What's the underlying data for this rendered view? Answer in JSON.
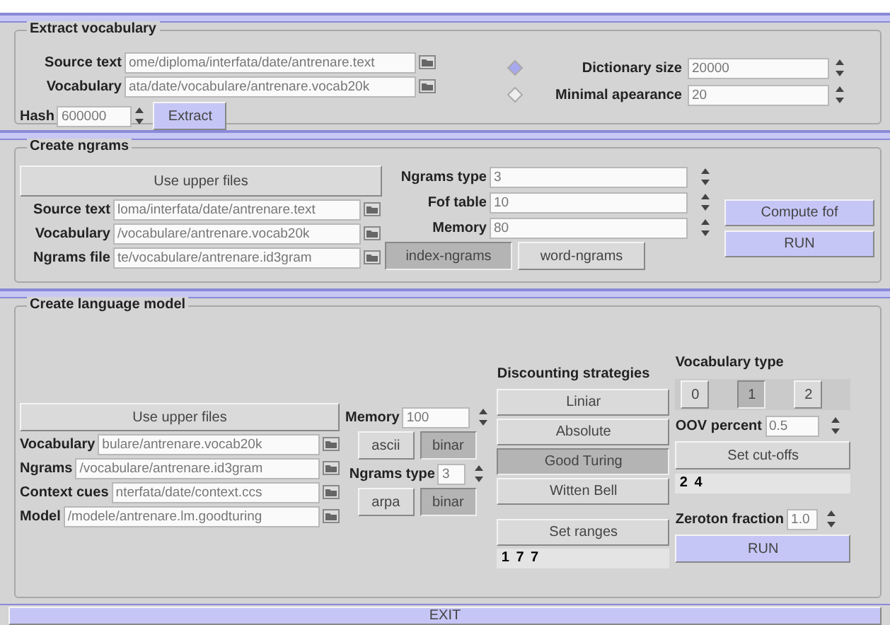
{
  "extract": {
    "title": "Extract vocabulary",
    "files": [
      {
        "label": "Source text",
        "value": "ome/diploma/interfata/date/antrenare.text"
      },
      {
        "label": "Vocabulary",
        "value": "ata/date/vocabulare/antrenare.vocab20k"
      }
    ],
    "hash": {
      "label": "Hash",
      "value": "600000"
    },
    "extract_button": "Extract",
    "options": [
      {
        "label": "Dictionary size",
        "value": "20000",
        "selected": true
      },
      {
        "label": "Minimal apearance",
        "value": "20",
        "selected": false
      }
    ]
  },
  "ngrams": {
    "title": "Create ngrams",
    "use_upper": "Use upper files",
    "files": [
      {
        "label": "Source text",
        "value": "loma/interfata/date/antrenare.text"
      },
      {
        "label": "Vocabulary",
        "value": "/vocabulare/antrenare.vocab20k"
      },
      {
        "label": "Ngrams file",
        "value": "te/vocabulare/antrenare.id3gram"
      }
    ],
    "params": [
      {
        "label": "Ngrams type",
        "value": "3"
      },
      {
        "label": "Fof table",
        "value": "10"
      },
      {
        "label": "Memory",
        "value": "80"
      }
    ],
    "modes": [
      {
        "label": "index-ngrams",
        "selected": true
      },
      {
        "label": "word-ngrams",
        "selected": false
      }
    ],
    "compute_button": "Compute fof",
    "run_button": "RUN"
  },
  "language_model": {
    "title": "Create language model",
    "use_upper": "Use upper files",
    "files": [
      {
        "label": "Vocabulary",
        "value": "bulare/antrenare.vocab20k"
      },
      {
        "label": "Ngrams",
        "value": "/vocabulare/antrenare.id3gram"
      },
      {
        "label": "Context cues",
        "value": "nterfata/date/context.ccs"
      },
      {
        "label": "Model",
        "value": "/modele/antrenare.lm.goodturing"
      }
    ],
    "memory": {
      "label": "Memory",
      "value": "100"
    },
    "memory_format": [
      {
        "label": "ascii",
        "selected": false
      },
      {
        "label": "binar",
        "selected": true
      }
    ],
    "ngrams_type": {
      "label": "Ngrams type",
      "value": "3"
    },
    "output_format": [
      {
        "label": "arpa",
        "selected": false
      },
      {
        "label": "binar",
        "selected": true
      }
    ],
    "discounting": {
      "title": "Discounting strategies",
      "options": [
        {
          "label": "Liniar",
          "selected": false
        },
        {
          "label": "Absolute",
          "selected": false
        },
        {
          "label": "Good Turing",
          "selected": true
        },
        {
          "label": "Witten Bell",
          "selected": false
        }
      ],
      "set_ranges": "Set ranges",
      "ranges_reading": "1 7 7"
    },
    "vocabulary_type": {
      "title": "Vocabulary type",
      "options": [
        {
          "label": "0",
          "selected": false
        },
        {
          "label": "1",
          "selected": true
        },
        {
          "label": "2",
          "selected": false
        }
      ]
    },
    "oov": {
      "label": "OOV percent",
      "value": "0.5"
    },
    "cutoffs_button": "Set cut-offs",
    "cutoffs_reading": "2 4",
    "zeroton": {
      "label": "Zeroton fraction",
      "value": "1.0"
    },
    "run_button": "RUN"
  },
  "exit_button": "EXIT"
}
